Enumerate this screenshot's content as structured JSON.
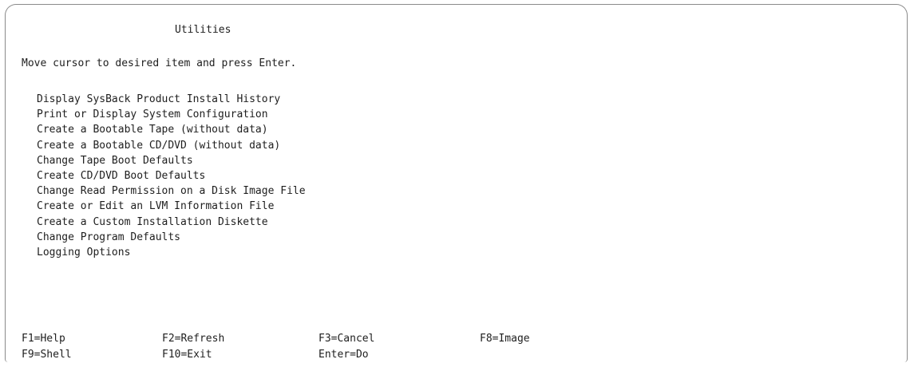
{
  "screen": {
    "title": "Utilities",
    "instruction": "Move cursor to desired item and press Enter."
  },
  "menu": {
    "items": [
      {
        "label": "Display SysBack Product Install History"
      },
      {
        "label": "Print or Display System Configuration"
      },
      {
        "label": "Create a Bootable Tape (without data)"
      },
      {
        "label": "Create a Bootable CD/DVD (without data)"
      },
      {
        "label": "Change Tape Boot Defaults"
      },
      {
        "label": "Create CD/DVD Boot Defaults"
      },
      {
        "label": "Change Read Permission on a Disk Image File"
      },
      {
        "label": "Create or Edit an LVM Information File"
      },
      {
        "label": "Create a Custom Installation Diskette"
      },
      {
        "label": "Change Program Defaults"
      },
      {
        "label": "Logging Options"
      }
    ]
  },
  "function_keys": {
    "row1": [
      "F1=Help",
      "F2=Refresh",
      "F3=Cancel",
      "F8=Image"
    ],
    "row2": [
      "F9=Shell",
      "F10=Exit",
      "Enter=Do"
    ]
  }
}
